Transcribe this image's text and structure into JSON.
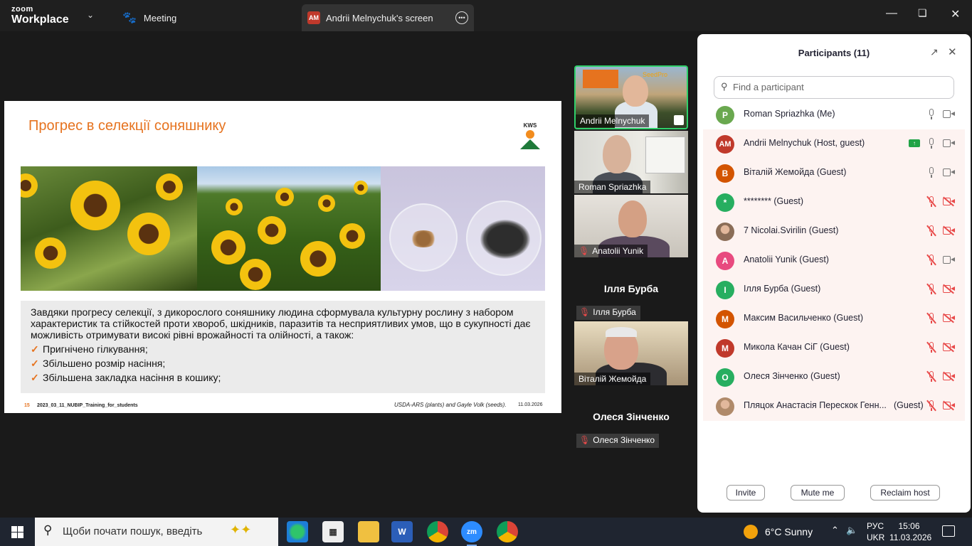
{
  "app": {
    "brand_top": "zoom",
    "brand_bottom": "Workplace"
  },
  "tabs": {
    "meeting": "Meeting",
    "share": "Andrii Melnychuk's screen",
    "share_badge": "AM"
  },
  "slide": {
    "title": "Прогрес в селекції соняшнику",
    "logo_text": "KWS",
    "body": "Завдяки прогресу селекції, з дикорослого соняшнику людина сформувала культурну рослину з набором характеристик та стійкостей проти хвороб, шкідників, паразитів та несприятливих умов, що в сукупності дає можливість отримувати високі рівні врожайності та олійності, а також:",
    "bullets": [
      "Пригнічено гілкування;",
      "Збільшено розмір насіння;",
      "Збільшена закладка насіння в кошику;"
    ],
    "page_number": "15",
    "file_name": "2023_03_11_NUBIP_Training_for_students",
    "source": "USDA-ARS (plants) and Gayle Volk (seeds).",
    "date": "11.03.2026"
  },
  "videos": [
    {
      "name": "Andrii Melnychuk"
    },
    {
      "name": "Roman Spriazhka"
    },
    {
      "name": "Anatolii Yunik",
      "muted": true
    },
    {
      "name": "Ілля Бурба",
      "muted": true,
      "video_off": true
    },
    {
      "name": "Віталій Жемойда"
    },
    {
      "name": "Олеся Зінченко",
      "muted": true,
      "video_off": true
    }
  ],
  "panel": {
    "title": "Participants (11)",
    "search_placeholder": "Find a participant",
    "participants": [
      {
        "initials": "P",
        "name": "Roman Spriazhka (Me)",
        "color": "#6aa84f",
        "mic": "on",
        "cam": "on"
      },
      {
        "initials": "AM",
        "name": "Andrii Melnychuk (Host, guest)",
        "color": "#c0392b",
        "mic": "on",
        "cam": "on",
        "sharing": true
      },
      {
        "initials": "В",
        "name": "Віталій Жемойда (Guest)",
        "color": "#d35400",
        "mic": "on",
        "cam": "on"
      },
      {
        "initials": "*",
        "name": "******** (Guest)",
        "color": "#27ae60",
        "mic": "off",
        "cam": "off"
      },
      {
        "initials": "",
        "name": "7 Nicolai.Svirilin (Guest)",
        "color": "#8a6d57",
        "mic": "off",
        "cam": "off",
        "photo": true
      },
      {
        "initials": "A",
        "name": "Anatolii Yunik (Guest)",
        "color": "#e84a7f",
        "mic": "off",
        "cam": "on"
      },
      {
        "initials": "I",
        "name": "Ілля Бурба (Guest)",
        "color": "#27ae60",
        "mic": "off",
        "cam": "off"
      },
      {
        "initials": "M",
        "name": "Максим Васильченко (Guest)",
        "color": "#d35400",
        "mic": "off",
        "cam": "off"
      },
      {
        "initials": "M",
        "name": "Микола Качан СіГ (Guest)",
        "color": "#c0392b",
        "mic": "off",
        "cam": "off"
      },
      {
        "initials": "O",
        "name": "Олеся Зінченко (Guest)",
        "color": "#27ae60",
        "mic": "off",
        "cam": "off"
      },
      {
        "initials": "",
        "name": "Пляцок Анастасія Перескок Генн...",
        "name_tail": "(Guest)",
        "color": "#b08a6a",
        "mic": "off",
        "cam": "off",
        "photo": true
      }
    ],
    "buttons": {
      "invite": "Invite",
      "mute_me": "Mute me",
      "reclaim_host": "Reclaim host"
    }
  },
  "taskbar": {
    "search_placeholder": "Щоби почати пошук, введіть",
    "weather": "6°C  Sunny",
    "lang_top": "РУС",
    "lang_bottom": "UKR",
    "time": "15:06",
    "date": "11.03.2026"
  }
}
